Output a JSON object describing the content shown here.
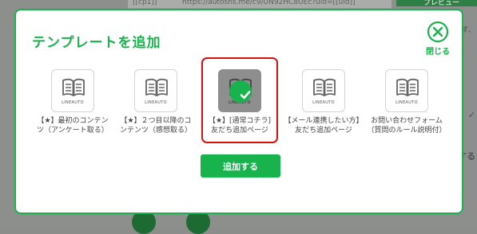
{
  "background": {
    "url_key": "[[cp1]]",
    "url_value": "https://autosns.me/c9/UN92HC8UEc?uid=[[uid]]",
    "preview_label": "プレビュー",
    "right_text_1": "す、",
    "right_text_2": "けする"
  },
  "modal": {
    "title": "テンプレートを追加",
    "close_label": "閉じる",
    "add_button_label": "追加する"
  },
  "templates": [
    {
      "brand": "LINEAUTO",
      "name": "【★】最初のコンテン\nツ（アンケート取る）",
      "selected": false
    },
    {
      "brand": "LINEAUTO",
      "name": "【★】２つ目以降のコ\nンテンツ（感想取る）",
      "selected": false
    },
    {
      "brand": "LINEAUTO",
      "name": "【★】[通常コチラ]\n友だち追加ページ",
      "selected": true
    },
    {
      "brand": "LINEAUTO",
      "name": "【メール連携したい方】\n友だち追加ページ",
      "selected": false
    },
    {
      "brand": "LINEAUTO",
      "name": "お問い合わせフォーム\n（質問のルール説明付）",
      "selected": false
    }
  ],
  "colors": {
    "accent": "#19b34e",
    "selection": "#d90f0f",
    "overlay": "#8c8f8c"
  },
  "icons": {
    "close": "close-circle-icon",
    "template": "book-icon",
    "selected": "checkmark-icon"
  }
}
